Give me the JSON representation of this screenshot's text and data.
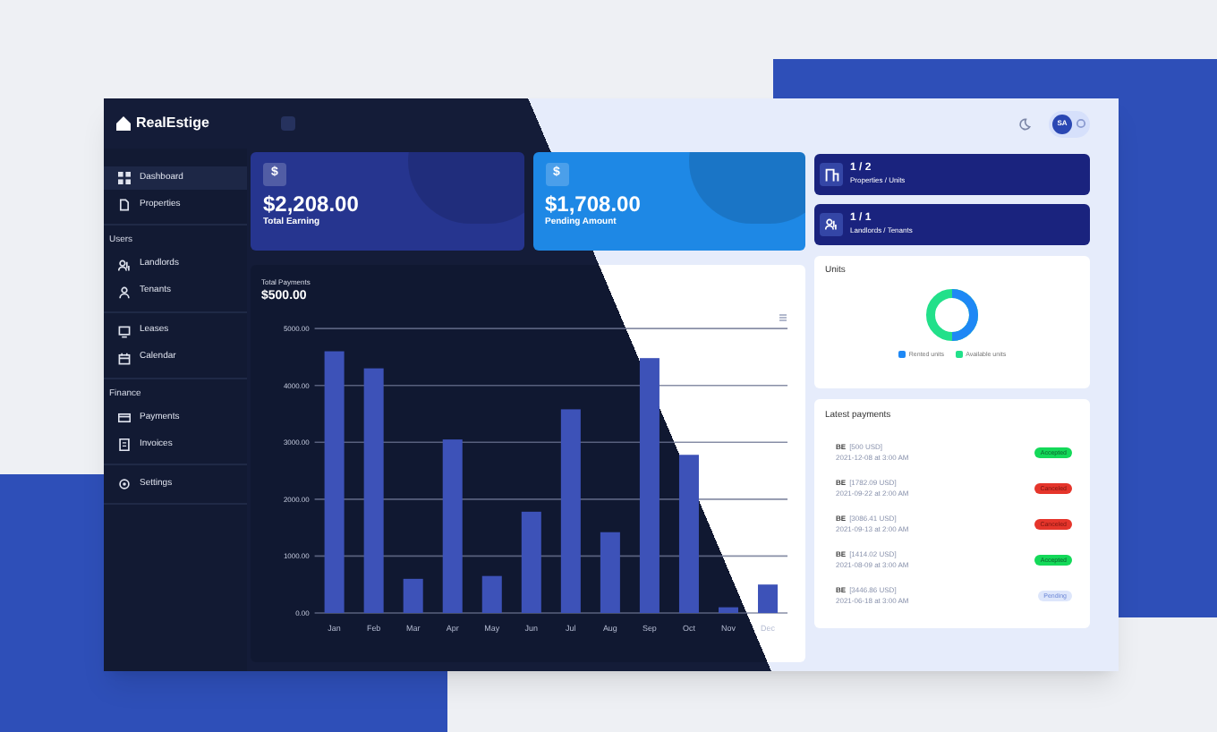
{
  "topbar": {
    "logo": "RealEstige",
    "avatar": "SA"
  },
  "sidebar": {
    "sections": [
      {
        "items": [
          {
            "label": "Dashboard",
            "selected": true
          },
          {
            "label": "Properties",
            "selected": false
          }
        ]
      },
      {
        "title": "Users",
        "items": [
          {
            "label": "Landlords",
            "selected": false
          },
          {
            "label": "Tenants",
            "selected": false
          }
        ]
      },
      {
        "items": [
          {
            "label": "Leases",
            "selected": false
          },
          {
            "label": "Calendar",
            "selected": false
          }
        ]
      },
      {
        "title": "Finance",
        "items": [
          {
            "label": "Payments",
            "selected": false
          },
          {
            "label": "Invoices",
            "selected": false
          }
        ]
      },
      {
        "items": [
          {
            "label": "Settings",
            "selected": false
          }
        ]
      }
    ]
  },
  "stats": [
    {
      "icon": "$",
      "value": "$2,208.00",
      "label": "Total Earning",
      "color": "#26358f"
    },
    {
      "icon": "$",
      "value": "$1,708.00",
      "label": "Pending Amount",
      "color": "#1e88e5"
    }
  ],
  "counters": [
    {
      "value": "1 / 2",
      "label": "Properties / Units"
    },
    {
      "value": "1 / 1",
      "label": "Landlords / Tenants"
    }
  ],
  "payments_chart": {
    "title": "Total Payments",
    "total": "$500.00",
    "chart_data": {
      "type": "bar",
      "categories": [
        "Jan",
        "Feb",
        "Mar",
        "Apr",
        "May",
        "Jun",
        "Jul",
        "Aug",
        "Sep",
        "Oct",
        "Nov",
        "Dec"
      ],
      "series": [
        {
          "color": "#3d52b8",
          "values": [
            4600,
            4300,
            600,
            3050,
            650,
            1780,
            3580,
            1420,
            4480,
            2780,
            100,
            500
          ]
        }
      ],
      "ylim": [
        0,
        5000
      ],
      "grid": true,
      "yticks": [
        {
          "value": 0,
          "label": "0.00"
        },
        {
          "value": 1000,
          "label": "1000.00"
        },
        {
          "value": 2000,
          "label": "2000.00"
        },
        {
          "value": 3000,
          "label": "3000.00"
        },
        {
          "value": 4000,
          "label": "4000.00"
        },
        {
          "value": 5000,
          "label": "5000.00"
        }
      ]
    }
  },
  "units": {
    "title": "Units",
    "legend": [
      {
        "label": "Rented units",
        "color": "#1e88f5"
      },
      {
        "label": "Available units",
        "color": "#22e08a"
      }
    ]
  },
  "latest_payments": {
    "title": "Latest payments",
    "rows": [
      {
        "payer": "BE",
        "amount": "[500 USD]",
        "date": "2021-12-08 at 3:00 AM",
        "status": "Accepted",
        "kind": "accepted"
      },
      {
        "payer": "BE",
        "amount": "[1782.09 USD]",
        "date": "2021-09-22 at 2:00 AM",
        "status": "Canceled",
        "kind": "canceled"
      },
      {
        "payer": "BE",
        "amount": "[3086.41 USD]",
        "date": "2021-09-13 at 2:00 AM",
        "status": "Canceled",
        "kind": "canceled"
      },
      {
        "payer": "BE",
        "amount": "[1414.02 USD]",
        "date": "2021-08-09 at 3:00 AM",
        "status": "Accepted",
        "kind": "accepted"
      },
      {
        "payer": "BE",
        "amount": "[3446.86 USD]",
        "date": "2021-06-18 at 3:00 AM",
        "status": "Pending",
        "kind": "pending"
      }
    ]
  }
}
